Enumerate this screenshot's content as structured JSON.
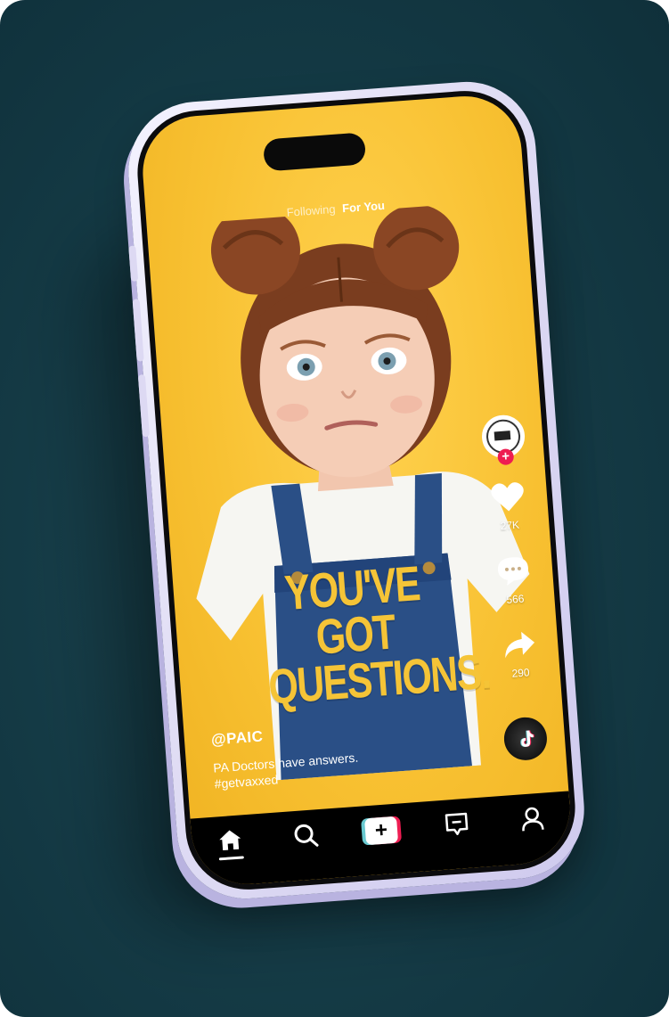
{
  "feed_tabs": {
    "following": "Following",
    "for_you": "For You"
  },
  "video": {
    "headline_line1": "YOU'VE GOT",
    "headline_line2": "QUESTIONS.",
    "username": "@PAIC",
    "caption": "PA Doctors have answers.",
    "hashtag": "#getvaxxed"
  },
  "actions": {
    "likes": "27K",
    "comments": "566",
    "shares": "290"
  },
  "nav": {
    "items": [
      "home-icon",
      "search-icon",
      "create-icon",
      "inbox-icon",
      "profile-icon"
    ],
    "create_symbol": "+"
  },
  "colors": {
    "background": "#143a45",
    "screen_bg": "#f8c132",
    "headline": "#f5c437",
    "follow_accent": "#ee1d52",
    "tiktok_cyan": "#69c9d0"
  }
}
